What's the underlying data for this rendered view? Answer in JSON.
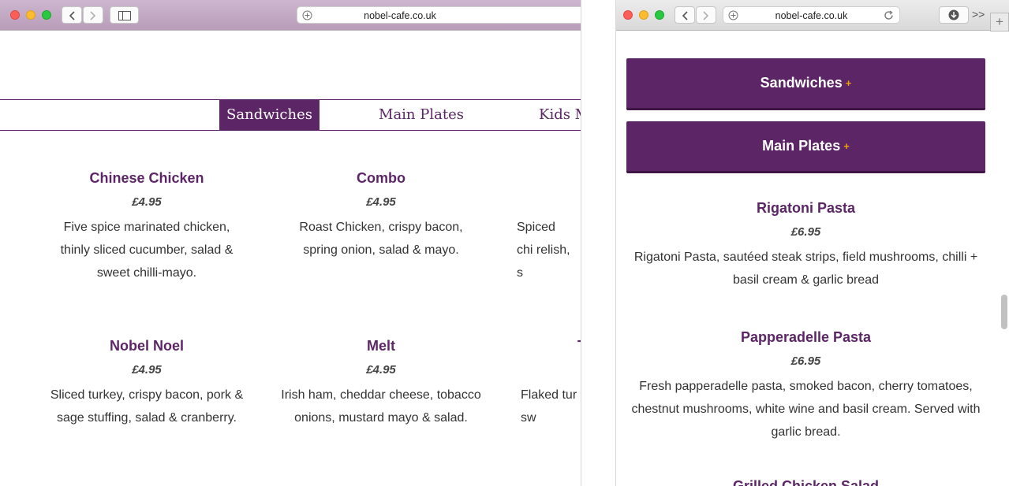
{
  "left": {
    "url": "nobel-cafe.co.uk",
    "tabs": [
      "Sandwiches",
      "Main Plates",
      "Kids M"
    ],
    "items": [
      {
        "name": "Chinese Chicken",
        "price": "£4.95",
        "desc": "Five spice marinated chicken, thinly sliced cucumber, salad & sweet chilli-mayo."
      },
      {
        "name": "Combo",
        "price": "£4.95",
        "desc": "Roast Chicken, crispy bacon, spring onion, salad & mayo."
      },
      {
        "name": "",
        "price": "",
        "desc": "Spiced chi relish, s"
      },
      {
        "name": "Nobel Noel",
        "price": "£4.95",
        "desc": "Sliced turkey, crispy bacon, pork & sage stuffing, salad & cranberry."
      },
      {
        "name": "Melt",
        "price": "£4.95",
        "desc": "Irish ham, cheddar cheese, tobacco onions, mustard mayo & salad."
      },
      {
        "name": "T",
        "price": "",
        "desc": "Flaked tur sw"
      }
    ]
  },
  "right": {
    "url": "nobel-cafe.co.uk",
    "accordions": [
      {
        "label": "Sandwiches",
        "icon": "+"
      },
      {
        "label": "Main Plates",
        "icon": "+"
      }
    ],
    "items": [
      {
        "name": "Rigatoni Pasta",
        "price": "£6.95",
        "desc": "Rigatoni Pasta, sautéed steak strips, field mushrooms, chilli + basil cream & garlic bread"
      },
      {
        "name": "Papperadelle Pasta",
        "price": "£6.95",
        "desc": "Fresh papperadelle pasta, smoked bacon, cherry tomatoes, chestnut mushrooms, white wine and basil cream. Served with garlic bread."
      },
      {
        "name": "Grilled Chicken Salad",
        "price": "",
        "desc": ""
      }
    ]
  },
  "colors": {
    "brand": "#5b2566",
    "accent": "#f0a500"
  }
}
